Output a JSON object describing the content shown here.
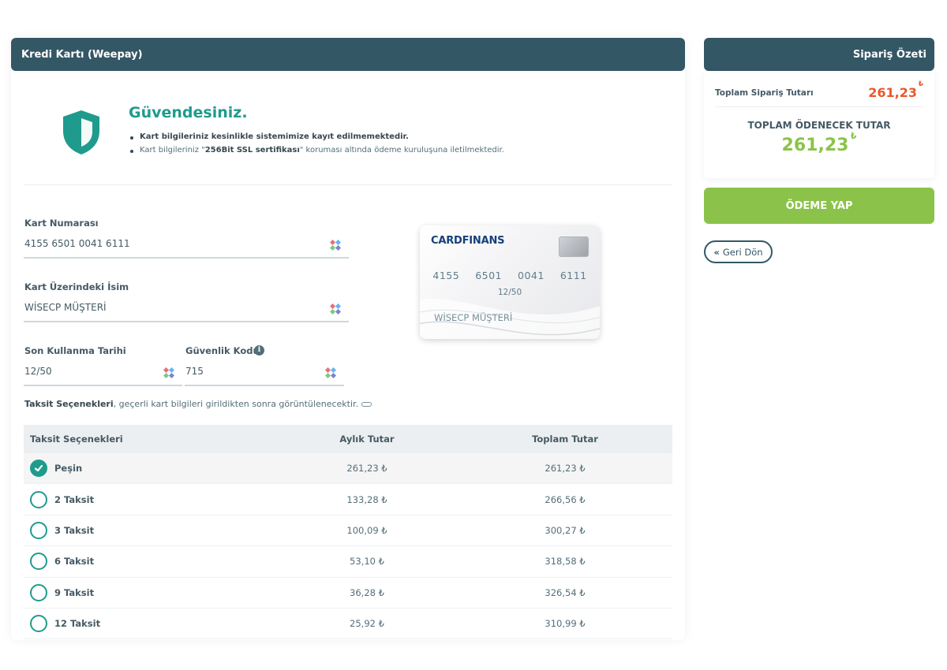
{
  "left_panel": {
    "header_title": "Kredi Kartı (Weepay)",
    "secure": {
      "title": "Güvendesiniz.",
      "line1": "Kart bilgileriniz kesinlikle sistemimize kayıt edilmemektedir.",
      "line2_prefix": "Kart bilgileriniz \"",
      "line2_bold": "256Bit SSL sertifikası",
      "line2_suffix": "\" koruması altında ödeme kuruluşuna iletilmektedir."
    },
    "fields": {
      "card_number_label": "Kart Numarası",
      "card_number_value": "4155 6501 0041 6111",
      "name_label": "Kart Üzerindeki İsim",
      "name_value": "WİSECP MÜŞTERİ",
      "expiry_label": "Son Kullanma Tarihi",
      "expiry_value": "12/50",
      "cvv_label": "Güvenlik Kodu",
      "cvv_value": "715"
    },
    "card_preview": {
      "brand": "CARDFINANS",
      "number_groups": [
        "4155",
        "6501",
        "0041",
        "6111"
      ],
      "expiry": "12/50",
      "holder": "WİSECP MÜŞTERİ"
    },
    "installment_note_bold": "Taksit Seçenekleri",
    "installment_note_text": ", geçerli kart bilgileri girildikten sonra görüntülenecektir.",
    "table": {
      "headers": [
        "Taksit Seçenekleri",
        "Aylık Tutar",
        "Toplam Tutar"
      ],
      "rows": [
        {
          "label": "Peşin",
          "monthly": "261,23 ₺",
          "total": "261,23 ₺",
          "selected": true
        },
        {
          "label": "2 Taksit",
          "monthly": "133,28 ₺",
          "total": "266,56 ₺",
          "selected": false
        },
        {
          "label": "3 Taksit",
          "monthly": "100,09 ₺",
          "total": "300,27 ₺",
          "selected": false
        },
        {
          "label": "6 Taksit",
          "monthly": "53,10 ₺",
          "total": "318,58 ₺",
          "selected": false
        },
        {
          "label": "9 Taksit",
          "monthly": "36,28 ₺",
          "total": "326,54 ₺",
          "selected": false
        },
        {
          "label": "12 Taksit",
          "monthly": "25,92 ₺",
          "total": "310,99 ₺",
          "selected": false
        }
      ]
    }
  },
  "right_panel": {
    "header_title": "Sipariş Özeti",
    "order_total_label": "Toplam Sipariş Tutarı",
    "order_total_value": "261,23",
    "payable_label": "TOPLAM ÖDENECEK TUTAR",
    "payable_value": "261,23",
    "currency_symbol": "₺",
    "pay_button_label": "ÖDEME YAP",
    "back_button_label": "Geri Dön"
  },
  "colors": {
    "header_bg": "#345766",
    "accent_teal": "#1f9b8d",
    "pay_green": "#8bc34a",
    "order_total_orange": "#e8582c"
  }
}
